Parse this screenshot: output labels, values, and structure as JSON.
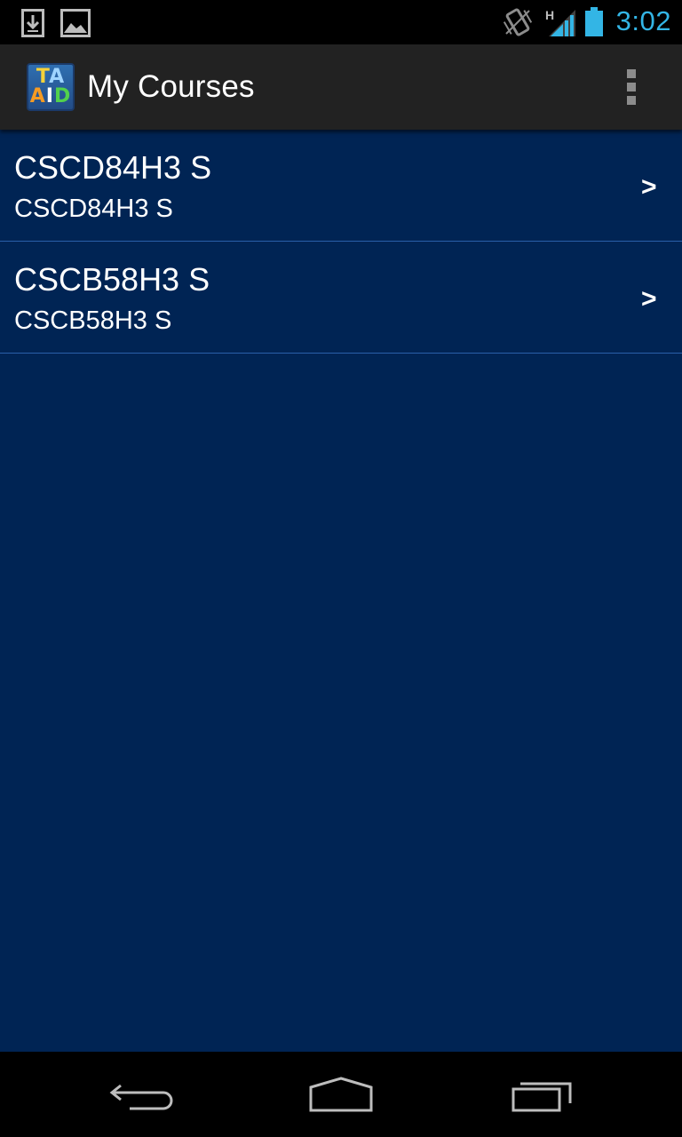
{
  "status_bar": {
    "time": "3:02",
    "network_label": "H",
    "icons": [
      "download-notification-icon",
      "image-notification-icon",
      "vibrate-icon",
      "signal-icon",
      "battery-icon"
    ],
    "accent_color": "#33b5e5"
  },
  "action_bar": {
    "app_icon_text": [
      "TA",
      "AID"
    ],
    "title": "My Courses",
    "overflow_icon": "overflow-menu-icon"
  },
  "courses": [
    {
      "title": "CSCD84H3 S",
      "subtitle": "CSCD84H3 S",
      "chevron": ">"
    },
    {
      "title": "CSCB58H3 S",
      "subtitle": "CSCB58H3 S",
      "chevron": ">"
    }
  ],
  "nav_bar": {
    "buttons": [
      "back-icon",
      "home-icon",
      "recent-apps-icon"
    ]
  },
  "colors": {
    "list_background": "#002454",
    "divider": "#2a5faa",
    "action_bar": "#222222"
  }
}
